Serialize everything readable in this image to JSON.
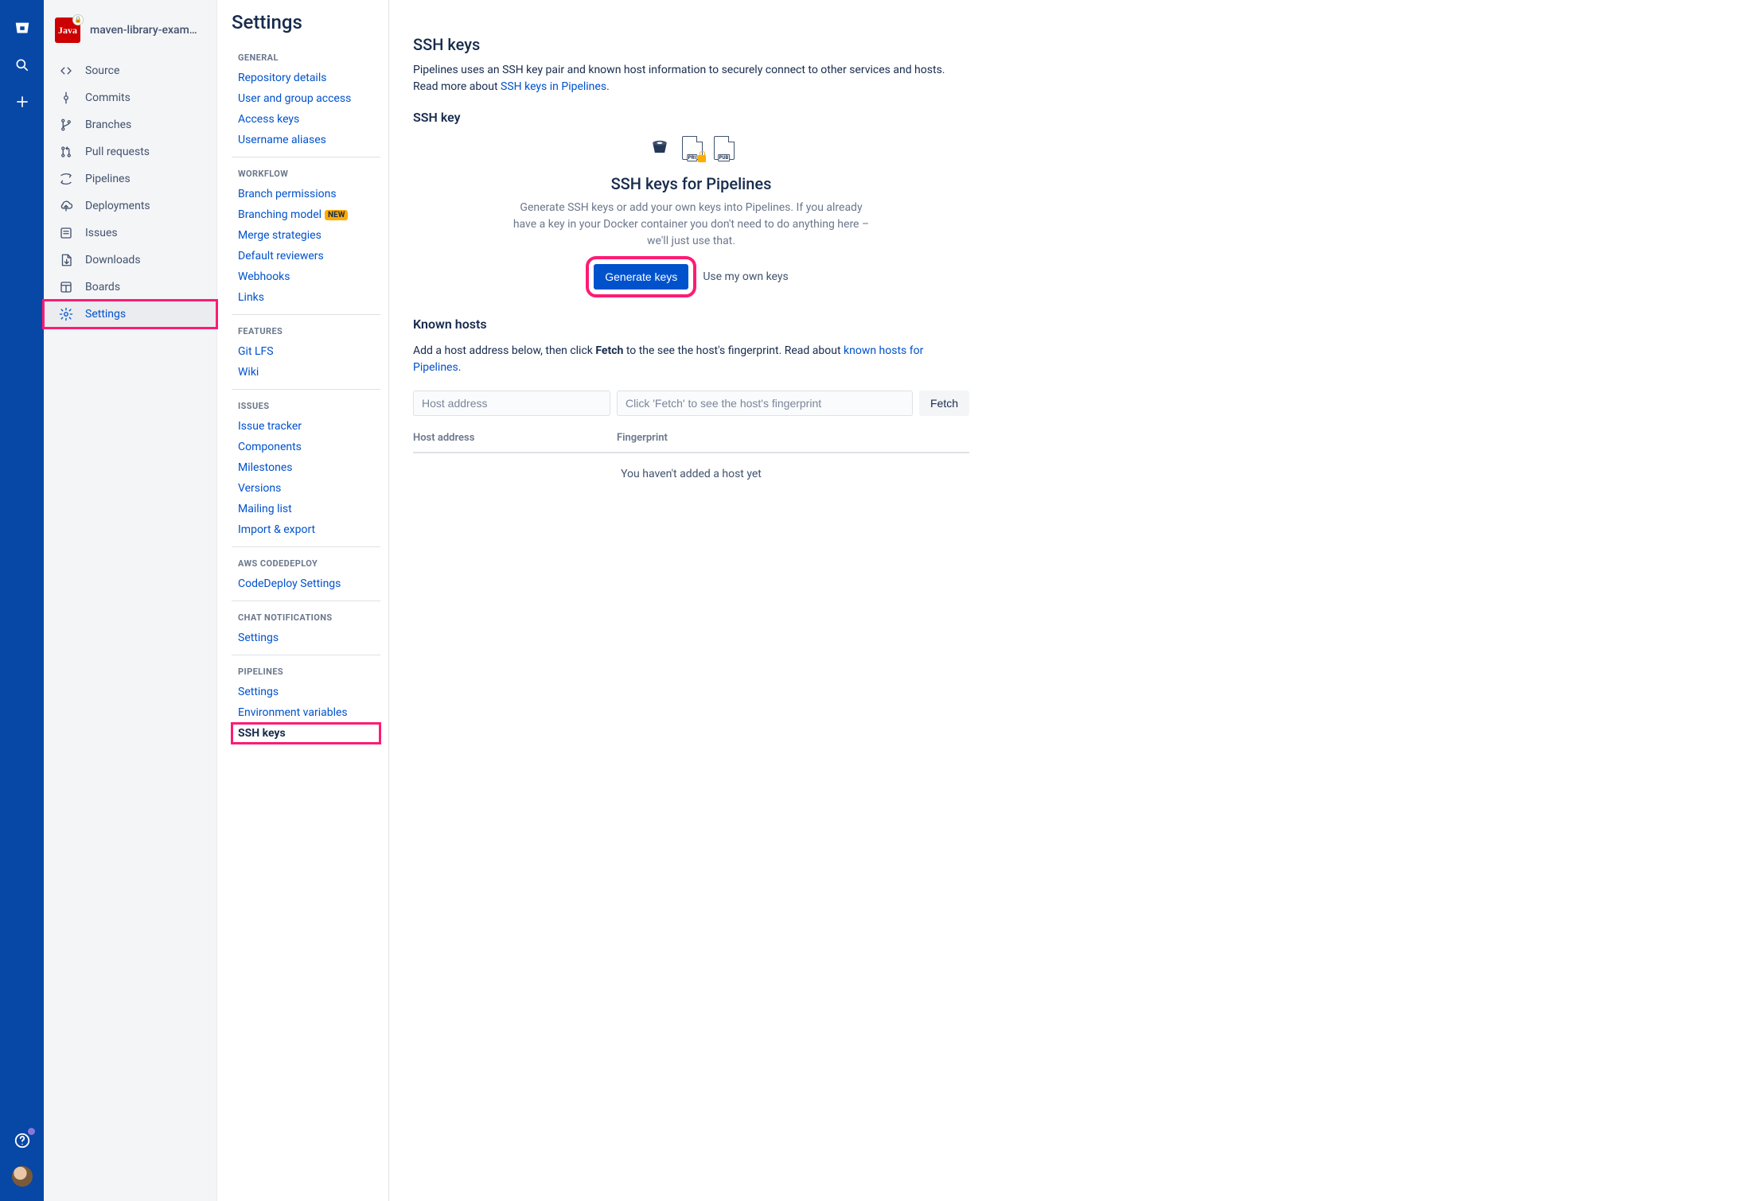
{
  "repo": {
    "name": "maven-library-exam…",
    "logo_text": "Java"
  },
  "repo_nav": {
    "items": [
      {
        "label": "Source",
        "icon": "code"
      },
      {
        "label": "Commits",
        "icon": "commit"
      },
      {
        "label": "Branches",
        "icon": "branch"
      },
      {
        "label": "Pull requests",
        "icon": "pr"
      },
      {
        "label": "Pipelines",
        "icon": "pipeline"
      },
      {
        "label": "Deployments",
        "icon": "cloud"
      },
      {
        "label": "Issues",
        "icon": "issue"
      },
      {
        "label": "Downloads",
        "icon": "download"
      },
      {
        "label": "Boards",
        "icon": "board"
      },
      {
        "label": "Settings",
        "icon": "gear",
        "active": true,
        "highlighted": true
      }
    ]
  },
  "settings": {
    "title": "Settings",
    "groups": [
      {
        "title": "GENERAL",
        "items": [
          {
            "label": "Repository details"
          },
          {
            "label": "User and group access"
          },
          {
            "label": "Access keys"
          },
          {
            "label": "Username aliases"
          }
        ]
      },
      {
        "title": "WORKFLOW",
        "items": [
          {
            "label": "Branch permissions"
          },
          {
            "label": "Branching model",
            "badge": "NEW"
          },
          {
            "label": "Merge strategies"
          },
          {
            "label": "Default reviewers"
          },
          {
            "label": "Webhooks"
          },
          {
            "label": "Links"
          }
        ]
      },
      {
        "title": "FEATURES",
        "items": [
          {
            "label": "Git LFS"
          },
          {
            "label": "Wiki"
          }
        ]
      },
      {
        "title": "ISSUES",
        "items": [
          {
            "label": "Issue tracker"
          },
          {
            "label": "Components"
          },
          {
            "label": "Milestones"
          },
          {
            "label": "Versions"
          },
          {
            "label": "Mailing list"
          },
          {
            "label": "Import & export"
          }
        ]
      },
      {
        "title": "AWS CODEDEPLOY",
        "items": [
          {
            "label": "CodeDeploy Settings"
          }
        ]
      },
      {
        "title": "CHAT NOTIFICATIONS",
        "items": [
          {
            "label": "Settings"
          }
        ]
      },
      {
        "title": "PIPELINES",
        "items": [
          {
            "label": "Settings"
          },
          {
            "label": "Environment variables"
          },
          {
            "label": "SSH keys",
            "current": true,
            "highlighted": true
          }
        ]
      }
    ]
  },
  "main": {
    "heading": "SSH keys",
    "intro_pre": "Pipelines uses an SSH key pair and known host information to securely connect to other services and hosts. Read more about ",
    "intro_link": "SSH keys in Pipelines",
    "intro_post": ".",
    "ssh_key_label": "SSH key",
    "pipelines_heading": "SSH keys for Pipelines",
    "pipelines_desc": "Generate SSH keys or add your own keys into Pipelines. If you already have a key in your Docker container you don't need to do anything here – we'll just use that.",
    "generate_btn": "Generate keys",
    "use_own": "Use my own keys",
    "file_pri": "PRI",
    "file_pub": "PUB",
    "known_hosts_heading": "Known hosts",
    "kh_intro_pre": "Add a host address below, then click ",
    "kh_intro_bold": "Fetch",
    "kh_intro_mid": " to the see the host's fingerprint. Read about ",
    "kh_intro_link": "known hosts for Pipelines",
    "kh_intro_post": ".",
    "host_placeholder": "Host address",
    "fp_placeholder": "Click 'Fetch' to see the host's fingerprint",
    "fetch_btn": "Fetch",
    "col_host": "Host address",
    "col_fp": "Fingerprint",
    "empty_hosts": "You haven't added a host yet"
  }
}
